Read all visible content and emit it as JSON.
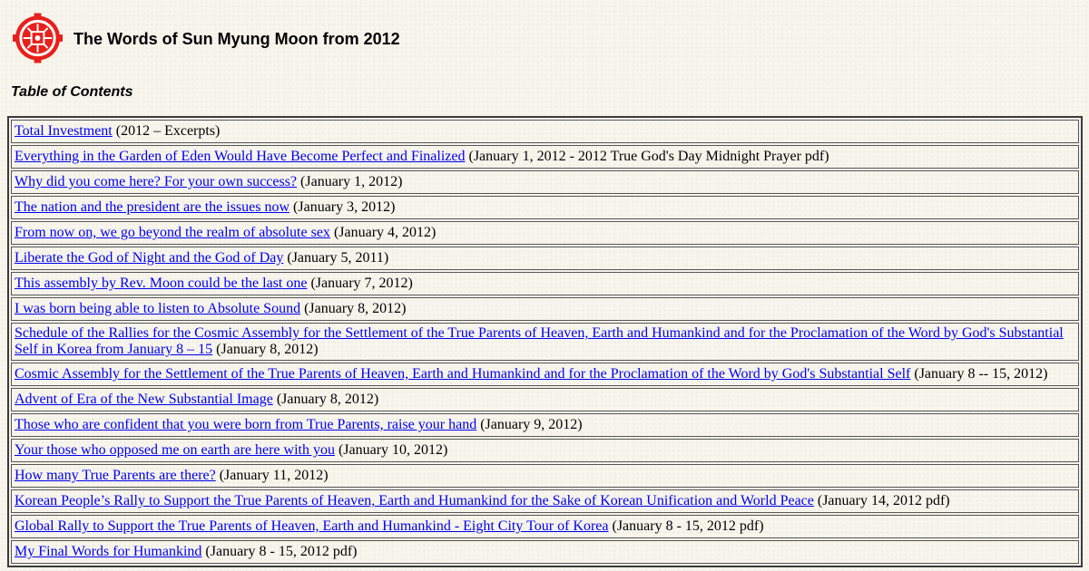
{
  "site": {
    "title": "The Words of Sun Myung Moon from 2012",
    "logo_icon": "unification-church-emblem",
    "logo_color": "#e8201c"
  },
  "toc": {
    "heading": "Table of Contents",
    "entries": [
      {
        "title": "Total Investment",
        "date": "(2012 – Excerpts)"
      },
      {
        "title": "Everything in the Garden of Eden Would Have Become Perfect and Finalized",
        "date": "(January 1, 2012 - 2012 True God's Day Midnight Prayer pdf)"
      },
      {
        "title": "Why did you come here? For your own success?",
        "date": "(January 1, 2012)"
      },
      {
        "title": "The nation and the president are the issues now",
        "date": "(January 3, 2012)"
      },
      {
        "title": "From now on, we go beyond the realm of absolute sex",
        "date": "(January 4, 2012)"
      },
      {
        "title": "Liberate the God of Night and the God of Day",
        "date": "(January 5, 2011)"
      },
      {
        "title": "This assembly by Rev. Moon could be the last one",
        "date": "(January 7, 2012)"
      },
      {
        "title": "I was born being able to listen to Absolute Sound",
        "date": "(January 8, 2012)"
      },
      {
        "title": "Schedule of the Rallies for the Cosmic Assembly for the Settlement of the True Parents of Heaven, Earth and Humankind and for the Proclamation of the Word by God's Substantial Self in Korea from January 8 – 15",
        "date": "(January 8, 2012)"
      },
      {
        "title": "Cosmic Assembly for the Settlement of the True Parents of Heaven, Earth and Humankind and for the Proclamation of the Word by God's Substantial Self",
        "date": "(January 8 -- 15, 2012)"
      },
      {
        "title": "Advent of Era of the New Substantial Image",
        "date": "(January 8, 2012)"
      },
      {
        "title": "Those who are confident that you were born from True Parents, raise your hand",
        "date": "(January 9, 2012)"
      },
      {
        "title": "Your those who opposed me on earth are here with you",
        "date": "(January 10, 2012)"
      },
      {
        "title": "How many True Parents are there?",
        "date": "(January 11, 2012)"
      },
      {
        "title": "Korean People’s Rally to Support the True Parents of Heaven, Earth and Humankind for the Sake of Korean Unification and World Peace",
        "date": "(January 14, 2012 pdf)"
      },
      {
        "title": "Global Rally to Support the True Parents of Heaven, Earth and Humankind - Eight City Tour of Korea",
        "date": "(January 8 - 15, 2012 pdf)"
      },
      {
        "title": "My Final Words for Humankind",
        "date": "(January 8 - 15, 2012 pdf)"
      }
    ]
  }
}
